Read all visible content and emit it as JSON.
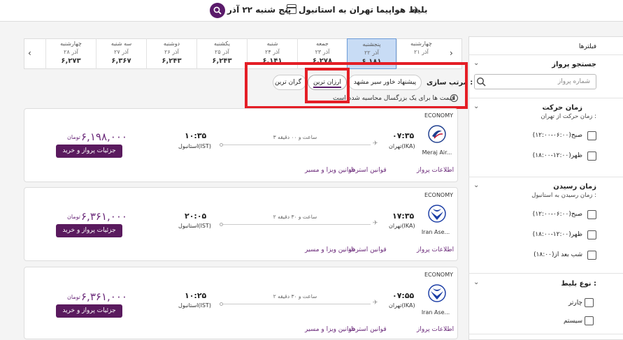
{
  "header": {
    "route_title": "بلیط هواپیما تهران به استانبول",
    "date_title": "پنج شنبه ۲۲ آذر"
  },
  "filters": {
    "title": "فیلترها",
    "flight_search": {
      "title": "جستجو پرواز",
      "placeholder": "شماره پرواز"
    },
    "departure_time": {
      "title": "زمان حرکت",
      "subtitle": "زمان حرکت از تهران :",
      "options": [
        "صبح(۰۶:۰۰-۱۲:۰۰)",
        "ظهر(۱۲:۰۰-۱۸:۰۰)"
      ]
    },
    "arrival_time": {
      "title": "زمان رسیدن",
      "subtitle": "زمان رسیدن به استانبول :",
      "options": [
        "صبح(۰۶:۰۰-۱۲:۰۰)",
        "ظهر(۱۲:۰۰-۱۸:۰۰)",
        "شب بعد از(۱۸:۰۰)"
      ]
    },
    "ticket_type": {
      "title": "نوع بلیط :",
      "options": [
        "چارتر",
        "سیستم"
      ]
    }
  },
  "dates": [
    {
      "day": "چهارشنبه",
      "date": "۲۱ آذر",
      "price": ""
    },
    {
      "day": "پنجشنبه",
      "date": "۲۲ آذر",
      "price": "۶,۱۸۱"
    },
    {
      "day": "جمعه",
      "date": "۲۳ آذر",
      "price": "۶,۲۷۸"
    },
    {
      "day": "شنبه",
      "date": "۲۴ آذر",
      "price": "۶,۱۴۱"
    },
    {
      "day": "یکشنبه",
      "date": "۲۵ آذر",
      "price": "۶,۲۴۳"
    },
    {
      "day": "دوشنبه",
      "date": "۲۶ آذر",
      "price": "۶,۲۴۳"
    },
    {
      "day": "سه شنبه",
      "date": "۲۷ آذر",
      "price": "۶,۳۶۷"
    },
    {
      "day": "چهارشنبه",
      "date": "۲۸ آذر",
      "price": "۶,۲۷۳"
    }
  ],
  "sort": {
    "label": "مرتب سازی :",
    "options": [
      "پیشنهاد خاور سیر مشهد",
      "ارزان ترین",
      "گران ترین"
    ],
    "notice": "قیمت ها برای یک بزرگسال محاسبه شده است"
  },
  "flights": [
    {
      "cabin": "ECONOMY",
      "airline": "Meraj Air...",
      "dep_time": "۰۷:۳۵",
      "dep_city": "تهران(IKA)",
      "duration": "۳ ساعت و ۰۰ دقیقه",
      "arr_time": "۱۰:۳۵",
      "arr_city": "استانبول(IST)",
      "price": "۶,۱۹۸,۰۰۰",
      "currency": "تومان",
      "buy_label": "جزئیات پرواز و خرید",
      "links": [
        "اطلاعات پرواز",
        "قوانین استرداد",
        "قوانین ویزا و مسیر"
      ]
    },
    {
      "cabin": "ECONOMY",
      "airline": "Iran Ase...",
      "dep_time": "۱۷:۳۵",
      "dep_city": "تهران(IKA)",
      "duration": "۲ ساعت و ۳۰ دقیقه",
      "arr_time": "۲۰:۰۵",
      "arr_city": "استانبول(IST)",
      "price": "۶,۳۶۱,۰۰۰",
      "currency": "تومان",
      "buy_label": "جزئیات پرواز و خرید",
      "links": [
        "اطلاعات پرواز",
        "قوانین استرداد",
        "قوانین ویزا و مسیر"
      ]
    },
    {
      "cabin": "ECONOMY",
      "airline": "Iran Ase...",
      "dep_time": "۰۷:۵۵",
      "dep_city": "تهران(IKA)",
      "duration": "۲ ساعت و ۳۰ دقیقه",
      "arr_time": "۱۰:۲۵",
      "arr_city": "استانبول(IST)",
      "price": "۶,۳۶۱,۰۰۰",
      "currency": "تومان",
      "buy_label": "جزئیات پرواز و خرید",
      "links": [
        "اطلاعات پرواز",
        "قوانین استرداد",
        "قوانین ویزا و مسیر"
      ]
    }
  ],
  "colors": {
    "brand": "#5a1a5e",
    "price": "#6b2a7a",
    "selected_date": "#c8dcf5",
    "highlight": "#e41e26",
    "meraj_logo": "#1f3f8f",
    "iran_aseman_logo": "#1d3fa6"
  }
}
